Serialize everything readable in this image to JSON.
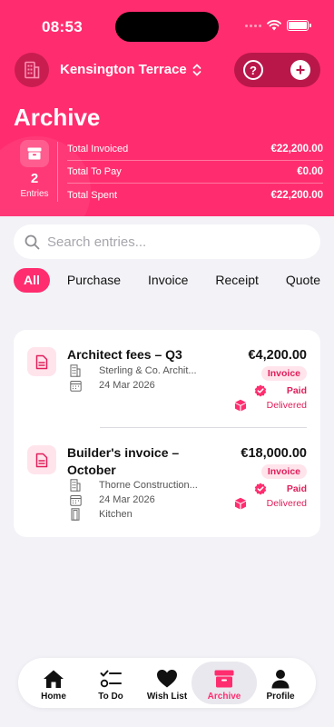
{
  "status_bar": {
    "time": "08:53"
  },
  "header": {
    "property_name": "Kensington Terrace",
    "help_label": "?",
    "add_label": "+",
    "page_title": "Archive",
    "entries_count": "2",
    "entries_label": "Entries",
    "summary": [
      {
        "label": "Total Invoiced",
        "value": "€22,200.00"
      },
      {
        "label": "Total To Pay",
        "value": "€0.00"
      },
      {
        "label": "Total Spent",
        "value": "€22,200.00"
      }
    ]
  },
  "search": {
    "placeholder": "Search entries..."
  },
  "filters": [
    "All",
    "Purchase",
    "Invoice",
    "Receipt",
    "Quote"
  ],
  "entries": [
    {
      "title": "Architect fees – Q3",
      "company": "Sterling & Co. Archit...",
      "date": "24 Mar 2026",
      "location": "",
      "amount": "€4,200.00",
      "type": "Invoice",
      "payment_status": "Paid",
      "delivery_status": "Delivered"
    },
    {
      "title": "Builder's invoice – October",
      "company": "Thorne Construction...",
      "date": "24 Mar 2026",
      "location": "Kitchen",
      "amount": "€18,000.00",
      "type": "Invoice",
      "payment_status": "Paid",
      "delivery_status": "Delivered"
    }
  ],
  "tabbar": [
    {
      "label": "Home",
      "icon": "home-icon"
    },
    {
      "label": "To Do",
      "icon": "checklist-icon"
    },
    {
      "label": "Wish List",
      "icon": "heart-icon"
    },
    {
      "label": "Archive",
      "icon": "archive-icon",
      "active": true
    },
    {
      "label": "Profile",
      "icon": "person-icon"
    }
  ],
  "colors": {
    "brand": "#ff2d6f",
    "brand_dark": "#b9174a",
    "background": "#f2f2f7"
  }
}
